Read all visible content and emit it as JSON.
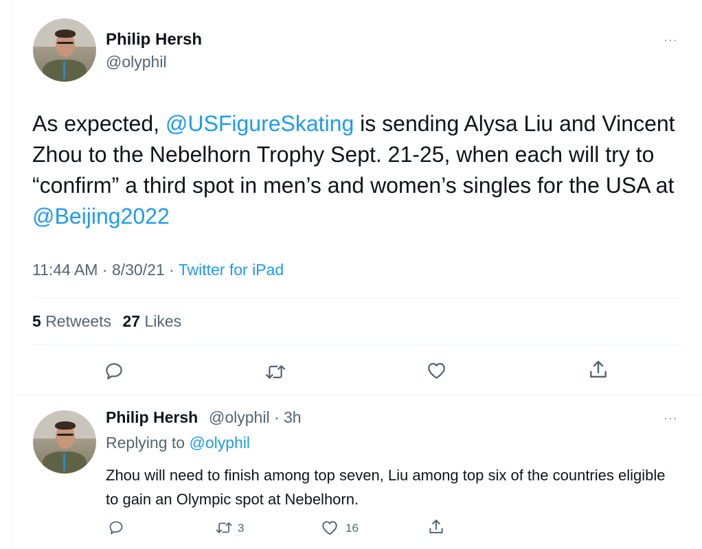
{
  "main_tweet": {
    "author_name": "Philip Hersh",
    "author_handle": "@olyphil",
    "text_part1": "As expected, ",
    "mention1": "@USFigureSkating",
    "text_part2": " is sending Alysa Liu and Vincent Zhou to the Nebelhorn Trophy Sept. 21-25, when each will try to “confirm” a third spot in men’s and women’s singles for the USA at ",
    "mention2": "@Beijing2022",
    "time": "11:44 AM",
    "date": "8/30/21",
    "separator": " · ",
    "source": "Twitter for iPad",
    "retweets_count": "5",
    "retweets_label": "Retweets",
    "likes_count": "27",
    "likes_label": "Likes",
    "more_label": "···"
  },
  "reply_tweet": {
    "author_name": "Philip Hersh",
    "author_handle": "@olyphil",
    "time_ago": "3h",
    "separator": " · ",
    "replying_to_label": "Replying to ",
    "replying_to_handle": "@olyphil",
    "text": "Zhou will need to finish among top seven, Liu among top six of the countries eligible to gain an Olympic spot at Nebelhorn.",
    "retweet_count": "3",
    "like_count": "16",
    "more_label": "···"
  },
  "icons": {
    "reply": "reply-icon",
    "retweet": "retweet-icon",
    "like": "heart-icon",
    "share": "share-icon"
  },
  "colors": {
    "accent": "#1d9bf0",
    "text": "#0f1419",
    "secondary": "#536471",
    "divider": "#eff3f4"
  }
}
